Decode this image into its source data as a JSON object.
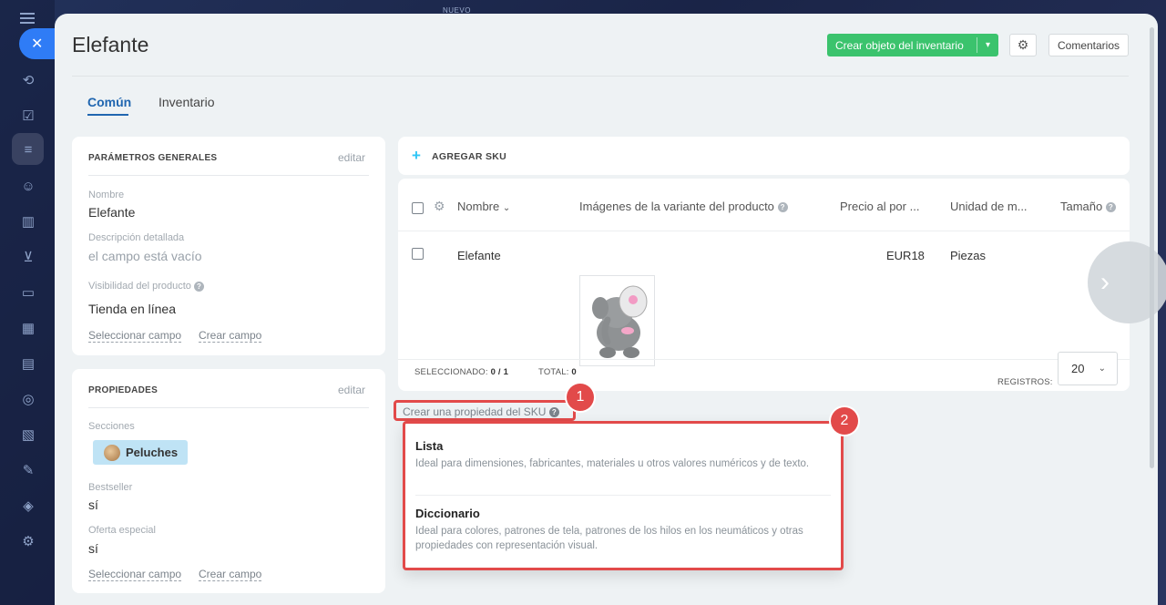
{
  "window": {
    "title": "Elefante"
  },
  "header": {
    "create_button": "Crear objeto del inventario",
    "comments_button": "Comentarios"
  },
  "background": {
    "label": "NUEVO"
  },
  "tabs": [
    {
      "label": "Común",
      "active": true
    },
    {
      "label": "Inventario",
      "active": false
    }
  ],
  "general": {
    "title": "PARÁMETROS GENERALES",
    "edit": "editar",
    "fields": [
      {
        "label": "Nombre",
        "value": "Elefante"
      },
      {
        "label": "Descripción detallada",
        "value": "el campo está vacío"
      },
      {
        "label": "Visibilidad del producto",
        "value": "Tienda en línea"
      }
    ],
    "select_field": "Seleccionar campo",
    "create_field": "Crear campo"
  },
  "properties": {
    "title": "PROPIEDADES",
    "edit": "editar",
    "sections_label": "Secciones",
    "section_tag": "Peluches",
    "fields": [
      {
        "label": "Bestseller",
        "value": "sí"
      },
      {
        "label": "Oferta especial",
        "value": "sí"
      }
    ],
    "select_field": "Seleccionar campo",
    "create_field": "Crear campo"
  },
  "sku": {
    "add_label": "AGREGAR SKU",
    "columns": [
      "Nombre",
      "Imágenes de la variante del producto",
      "Precio al por ...",
      "Unidad de m...",
      "Tamaño"
    ],
    "rows": [
      {
        "name": "Elefante",
        "price": "EUR18",
        "unit": "Piezas",
        "size": ""
      }
    ],
    "selected_label": "SELECCIONADO:",
    "selected_value": "0 / 1",
    "total_label": "TOTAL:",
    "total_value": "0",
    "records_label": "REGISTROS:",
    "records_value": "20"
  },
  "create_property": {
    "link": "Crear una propiedad del SKU",
    "badge_1": "1",
    "badge_2": "2",
    "options": [
      {
        "title": "Lista",
        "description": "Ideal para dimensiones, fabricantes, materiales u otros valores numéricos y de texto."
      },
      {
        "title": "Diccionario",
        "description": "Ideal para colores, patrones de tela, patrones de los hilos en los neumáticos y otras propiedades con representación visual."
      }
    ]
  },
  "colors": {
    "accent": "#2066b0",
    "success": "#3bc36d",
    "callout": "#e24a4a"
  }
}
